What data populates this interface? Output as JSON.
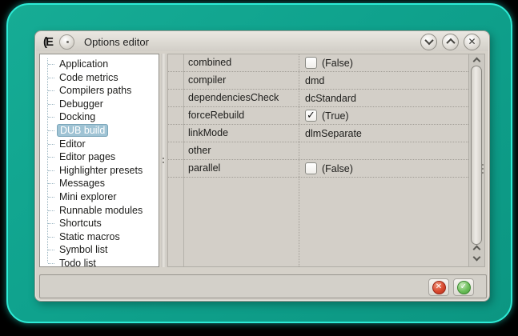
{
  "window": {
    "title": "Options editor",
    "app_logo_glyph": "(E"
  },
  "icons": {
    "close": "✕",
    "check": "✓",
    "cancel": "✕",
    "ok": "✓"
  },
  "sidebar": {
    "items": [
      "Application",
      "Code metrics",
      "Compilers paths",
      "Debugger",
      "Docking",
      "DUB build",
      "Editor",
      "Editor pages",
      "Highlighter presets",
      "Messages",
      "Mini explorer",
      "Runnable modules",
      "Shortcuts",
      "Static macros",
      "Symbol list",
      "Todo list"
    ],
    "selected": "DUB build"
  },
  "grid": {
    "rows": [
      {
        "name": "combined",
        "value": "(False)",
        "type": "bool",
        "checked": false
      },
      {
        "name": "compiler",
        "value": "dmd",
        "type": "text"
      },
      {
        "name": "dependenciesCheck",
        "value": "dcStandard",
        "type": "text"
      },
      {
        "name": "forceRebuild",
        "value": "(True)",
        "type": "bool",
        "checked": true
      },
      {
        "name": "linkMode",
        "value": "dlmSeparate",
        "type": "text"
      },
      {
        "name": "other",
        "value": "",
        "type": "text"
      },
      {
        "name": "parallel",
        "value": "(False)",
        "type": "bool",
        "checked": false
      }
    ]
  },
  "colors": {
    "frame_teal": "#0fa28d",
    "frame_glow": "#2debd6",
    "selection_blue": "#9fc3d4",
    "cancel_red": "#d9482e",
    "ok_green": "#5cb150",
    "window_gray": "#d5d1c9"
  }
}
